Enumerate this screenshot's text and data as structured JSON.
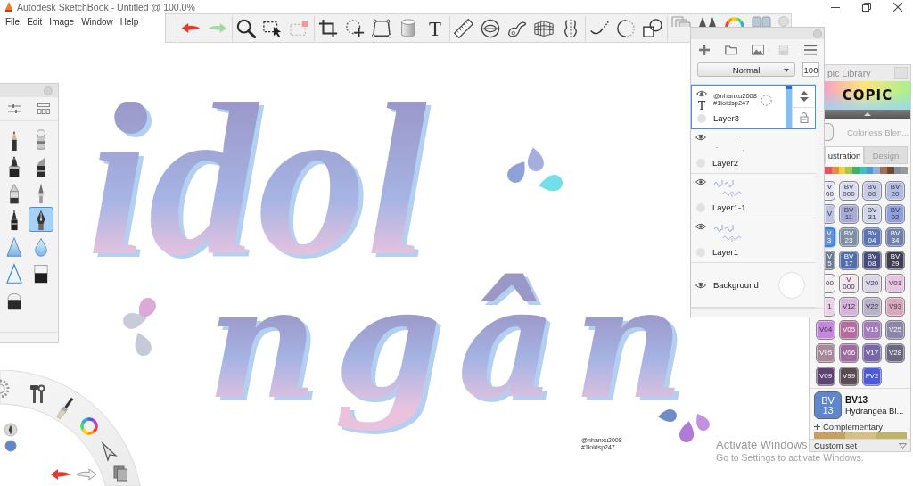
{
  "window": {
    "title": "Autodesk SketchBook - Untitled @ 100.0%"
  },
  "menu": [
    "File",
    "Edit",
    "Image",
    "Window",
    "Help"
  ],
  "toolbar": {
    "text_tool_glyph": "T"
  },
  "canvas": {
    "lettering": [
      "idol",
      "ngân"
    ],
    "signature": [
      "@nhanxu2008",
      "#1loidsp247"
    ]
  },
  "brush_palette": {
    "brushes": [
      {
        "selected": false
      },
      {
        "selected": false
      },
      {
        "selected": false
      },
      {
        "selected": false
      },
      {
        "selected": false
      },
      {
        "selected": false
      },
      {
        "selected": false
      },
      {
        "selected": true
      },
      {
        "selected": false
      },
      {
        "selected": false
      },
      {
        "selected": false
      },
      {
        "selected": false
      },
      {
        "selected": false
      }
    ]
  },
  "layers_panel": {
    "blend_mode": "Normal",
    "opacity": "100",
    "layers": [
      {
        "name": "Layer3",
        "kind": "text",
        "glyph": "T",
        "thumbnail_text": [
          "@nhanxu2008",
          "#1loidsp247"
        ],
        "visible": true,
        "selected": true,
        "level": 1
      },
      {
        "name": "Layer2",
        "kind": "marks",
        "visible": true,
        "selected": false
      },
      {
        "name": "Layer1-1",
        "kind": "paint",
        "visible": true,
        "selected": false
      },
      {
        "name": "Layer1",
        "kind": "paint",
        "visible": true,
        "selected": false
      },
      {
        "name": "Background",
        "kind": "background",
        "visible": true,
        "selected": false
      }
    ]
  },
  "copic_library": {
    "title": "pic Library",
    "logo": "COPIC",
    "blender": "Colorless Blen...",
    "tabs": [
      {
        "label": "ustration",
        "selected": true
      },
      {
        "label": "Design",
        "selected": false
      }
    ],
    "families": [
      {
        "color": "#e8525e"
      },
      {
        "color": "#f08a3c"
      },
      {
        "color": "#f3d23e"
      },
      {
        "color": "#a9c84a"
      },
      {
        "color": "#3bb36a"
      },
      {
        "color": "#3cc0c8"
      },
      {
        "color": "#4d9ad6"
      },
      {
        "color": "#8fb0dc"
      },
      {
        "color": "#a07050"
      },
      {
        "color": "#704830"
      },
      {
        "color": "#8090a0"
      },
      {
        "color": "#9a9a9a"
      }
    ],
    "markers": [
      {
        "lines": [
          "V",
          "00"
        ],
        "color": "#e6e6f3",
        "kind": "cut",
        "selected": false
      },
      {
        "lines": [
          "BV",
          "000"
        ],
        "color": "#d9dbef",
        "kind": "full",
        "selected": false
      },
      {
        "lines": [
          "BV",
          "00"
        ],
        "color": "#c7cbe8",
        "kind": "full",
        "selected": false
      },
      {
        "lines": [
          "BV",
          "20"
        ],
        "color": "#b3bde3",
        "kind": "full",
        "selected": false
      },
      {
        "lines": [
          "V"
        ],
        "color": "#bcc3e2",
        "kind": "cut",
        "selected": false
      },
      {
        "lines": [
          "BV",
          "11"
        ],
        "color": "#a7acd6",
        "kind": "full",
        "selected": false
      },
      {
        "lines": [
          "BV",
          "31"
        ],
        "color": "#d2d6ea",
        "kind": "full",
        "selected": false
      },
      {
        "lines": [
          "BV",
          "02"
        ],
        "color": "#8fa1dc",
        "kind": "full",
        "selected": false
      },
      {
        "lines": [
          "V",
          "3"
        ],
        "color": "#6d8fd0",
        "kind": "cut",
        "selected": true
      },
      {
        "lines": [
          "BV",
          "23"
        ],
        "color": "#7e90a6",
        "kind": "full",
        "selected": false
      },
      {
        "lines": [
          "BV",
          "04"
        ],
        "color": "#5a74b8",
        "kind": "full",
        "selected": false
      },
      {
        "lines": [
          "BV",
          "34"
        ],
        "color": "#6f80ad",
        "kind": "full",
        "selected": false
      },
      {
        "lines": [
          "V",
          "5"
        ],
        "color": "#6f788f",
        "kind": "cut",
        "selected": false
      },
      {
        "lines": [
          "BV",
          "17"
        ],
        "color": "#506eae",
        "kind": "full",
        "selected": false
      },
      {
        "lines": [
          "BV",
          "08"
        ],
        "color": "#454c7e",
        "kind": "full",
        "selected": false
      },
      {
        "lines": [
          "BV",
          "29"
        ],
        "color": "#3f3c50",
        "kind": "full",
        "selected": false
      },
      {
        "lines": [
          "00"
        ],
        "color": "#f2ebf0",
        "kind": "cut",
        "selected": false
      },
      {
        "lines": [
          "V",
          "000"
        ],
        "color": "#f4e4ee",
        "kind": "full",
        "selected": false
      },
      {
        "lines": [
          "V20"
        ],
        "color": "#ddd6e5",
        "kind": "full",
        "selected": false
      },
      {
        "lines": [
          "V01"
        ],
        "color": "#e6c5de",
        "kind": "full",
        "selected": false
      },
      {
        "lines": [
          "1"
        ],
        "color": "#e9d2e3",
        "kind": "cut",
        "selected": false
      },
      {
        "lines": [
          "V12"
        ],
        "color": "#d9b4da",
        "kind": "full",
        "selected": false
      },
      {
        "lines": [
          "V22"
        ],
        "color": "#b9b3ca",
        "kind": "full",
        "selected": false
      },
      {
        "lines": [
          "V93"
        ],
        "color": "#d9a9bb",
        "kind": "full",
        "selected": false
      },
      {
        "lines": [
          "V04"
        ],
        "color": "#c487dc",
        "kind": "full",
        "selected": false
      },
      {
        "lines": [
          "V05"
        ],
        "color": "#b56d9f",
        "kind": "full",
        "selected": false
      },
      {
        "lines": [
          "V15"
        ],
        "color": "#a27cbb",
        "kind": "full",
        "selected": false
      },
      {
        "lines": [
          "V25"
        ],
        "color": "#8b86aa",
        "kind": "full",
        "selected": false
      },
      {
        "lines": [
          "V95"
        ],
        "color": "#a68a99",
        "kind": "full",
        "selected": false
      },
      {
        "lines": [
          "V06"
        ],
        "color": "#9e6b9f",
        "kind": "full",
        "selected": false
      },
      {
        "lines": [
          "V17"
        ],
        "color": "#7766aa",
        "kind": "full",
        "selected": false
      },
      {
        "lines": [
          "V28"
        ],
        "color": "#6b6882",
        "kind": "full",
        "selected": false
      },
      {
        "lines": [
          "V09"
        ],
        "color": "#5d4472",
        "kind": "full",
        "selected": false
      },
      {
        "lines": [
          "V99"
        ],
        "color": "#5b4b52",
        "kind": "full",
        "selected": false
      },
      {
        "lines": [
          "FV2"
        ],
        "color": "#4b5bd9",
        "kind": "full",
        "selected": false
      }
    ],
    "current": {
      "lines": [
        "BV",
        "13"
      ],
      "code": "BV13",
      "name": "Hydrangea Bl...",
      "color": "#5f87cf"
    },
    "complementary": {
      "label": "Complementary",
      "swatches": [
        {
          "color": "#c9a15f"
        },
        {
          "color": "#d6bf82"
        },
        {
          "color": "#bdb468"
        }
      ]
    },
    "set": "Custom set"
  },
  "os_notice": {
    "title": "Activate Windows",
    "text": "Go to Settings to activate Windows."
  }
}
